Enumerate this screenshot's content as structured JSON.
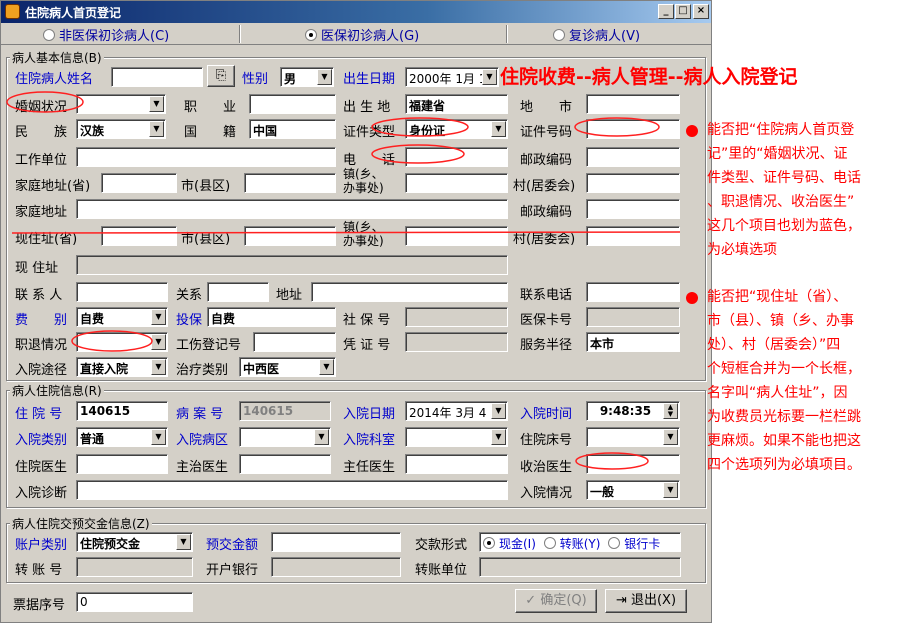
{
  "window": {
    "title": "住院病人首页登记",
    "minimize": "_",
    "maximize": "□",
    "close": "×"
  },
  "patient_type_tabs": [
    {
      "label": "非医保初诊病人(C)",
      "selected": false
    },
    {
      "label": "医保初诊病人(G)",
      "selected": true
    },
    {
      "label": "复诊病人(V)",
      "selected": false
    }
  ],
  "basic_info": {
    "group_title": "病人基本信息(B)",
    "name_label": "住院病人姓名",
    "name_value": "",
    "gender_label": "性别",
    "gender_value": "男",
    "birth_label": "出生日期",
    "birth_value": "2000年 1月 1",
    "marital_label": "婚姻状况",
    "marital_value": "",
    "occupation_label": "职　　业",
    "occupation_value": "",
    "birthplace_label": "出 生 地",
    "birthplace_value": "福建省",
    "region_label": "地　　市",
    "region_value": "",
    "ethnic_label": "民　　族",
    "ethnic_value": "汉族",
    "nationality_label": "国　　籍",
    "nationality_value": "中国",
    "id_type_label": "证件类型",
    "id_type_value": "身份证",
    "id_no_label": "证件号码",
    "id_no_value": "",
    "workplace_label": "工作单位",
    "workplace_value": "",
    "phone_label": "电　　话",
    "phone_value": "",
    "postcode_label": "邮政编码",
    "postcode_value": "",
    "home_province_label": "家庭地址(省)",
    "city_label": "市(县区)",
    "town_label": "镇(乡、",
    "town_label2": "办事处)",
    "village_label": "村(居委会)",
    "home_address_label": "家庭地址",
    "home_address_value": "",
    "postcode2_label": "邮政编码",
    "cur_province_label": "现住址(省)",
    "city2_label": "市(县区)",
    "town2_label": "镇(乡、",
    "town2_label2": "办事处)",
    "village2_label": "村(居委会)",
    "cur_address_label": "现 住址",
    "contact_label": "联 系 人",
    "relation_label": "关系",
    "address_label": "地址",
    "contact_phone_label": "联系电话",
    "fee_label": "费　　别",
    "fee_value": "自费",
    "insure_label": "投保",
    "insure_value": "自费",
    "social_label": "社 保 号",
    "medcard_label": "医保卡号",
    "retire_label": "职退情况",
    "injury_label": "工伤登记号",
    "voucher_label": "凭 证 号",
    "radius_label": "服务半径",
    "radius_value": "本市",
    "route_label": "入院途径",
    "route_value": "直接入院",
    "treat_label": "治疗类别",
    "treat_value": "中西医"
  },
  "stay_info": {
    "group_title": "病人住院信息(R)",
    "inpatient_no_label": "住 院 号",
    "inpatient_no_value": "140615",
    "case_no_label": "病 案 号",
    "case_no_value": "140615",
    "adm_date_label": "入院日期",
    "adm_date_value": "2014年 3月 4",
    "adm_time_label": "入院时间",
    "adm_time_value": "9:48:35",
    "adm_type_label": "入院类别",
    "adm_type_value": "普通",
    "ward_label": "入院病区",
    "dept_label": "入院科室",
    "bed_label": "住院床号",
    "doctor_label": "住院医生",
    "attending_label": "主治医生",
    "chief_label": "主任医生",
    "admit_doctor_label": "收治医生",
    "diagnosis_label": "入院诊断",
    "condition_label": "入院情况",
    "condition_value": "一般"
  },
  "deposit_info": {
    "group_title": "病人住院交预交金信息(Z)",
    "account_label": "账户类别",
    "account_value": "住院预交金",
    "amount_label": "预交金额",
    "paytype_label": "交款形式",
    "pay_options": [
      "现金(I)",
      "转账(Y)",
      "银行卡"
    ],
    "transfer_no_label": "转 账 号",
    "bank_label": "开户银行",
    "transfer_unit_label": "转账单位"
  },
  "footer": {
    "receipt_label": "票据序号",
    "receipt_value": "0",
    "confirm_label": "确定(Q)",
    "exit_label": "退出(X)"
  },
  "annotations": {
    "heading": "住院收费--病人管理--病人入院登记",
    "note1": [
      "能否把“住院病人首页登",
      "记”里的“婚姻状况、证",
      "件类型、证件号码、电话",
      "、职退情况、收治医生”",
      "这几个项目也划为蓝色，",
      "为必填选项"
    ],
    "note2": [
      "能否把“现住址（省）、",
      "市（县）、镇（乡、办事",
      "处）、村（居委会）”四",
      "个短框合并为一个长框，",
      "名字叫“病人住址”，因",
      "为收费员光标要一栏栏跳",
      "更麻烦。如果不能也把这",
      "四个选项列为必填项目。"
    ],
    "accent_color": "#ff0000"
  }
}
